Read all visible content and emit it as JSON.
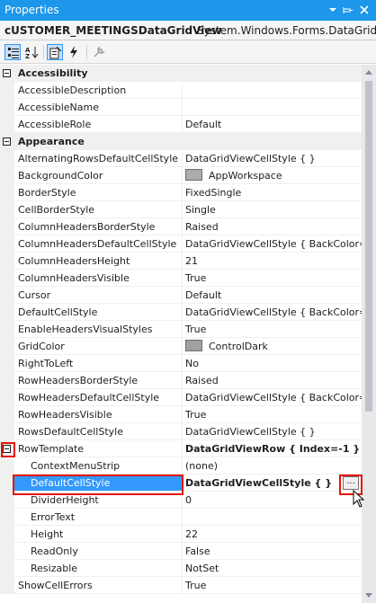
{
  "window": {
    "title": "Properties"
  },
  "object_selector": {
    "name": "cUSTOMER_MEETINGSDataGridView",
    "type": "System.Windows.Forms.DataGridVi"
  },
  "toolbar": {
    "buttons": [
      "categorized-icon",
      "alphabetical-icon",
      "properties-icon",
      "events-icon",
      "property-pages-icon"
    ]
  },
  "colors": {
    "accent": "#1c97ea",
    "selection": "#3399ff",
    "highlight_box": "#e51400",
    "app_workspace": "#ababab",
    "control_dark": "#a0a0a0"
  },
  "grid": {
    "rows": [
      {
        "kind": "category",
        "name": "Accessibility"
      },
      {
        "kind": "prop",
        "name": "AccessibleDescription",
        "value": ""
      },
      {
        "kind": "prop",
        "name": "AccessibleName",
        "value": ""
      },
      {
        "kind": "prop",
        "name": "AccessibleRole",
        "value": "Default"
      },
      {
        "kind": "category",
        "name": "Appearance"
      },
      {
        "kind": "prop",
        "name": "AlternatingRowsDefaultCellStyle",
        "value": "DataGridViewCellStyle { }"
      },
      {
        "kind": "prop",
        "name": "BackgroundColor",
        "value": "AppWorkspace",
        "swatch": "#ababab"
      },
      {
        "kind": "prop",
        "name": "BorderStyle",
        "value": "FixedSingle"
      },
      {
        "kind": "prop",
        "name": "CellBorderStyle",
        "value": "Single"
      },
      {
        "kind": "prop",
        "name": "ColumnHeadersBorderStyle",
        "value": "Raised"
      },
      {
        "kind": "prop",
        "name": "ColumnHeadersDefaultCellStyle",
        "value": "DataGridViewCellStyle { BackColor=C"
      },
      {
        "kind": "prop",
        "name": "ColumnHeadersHeight",
        "value": "21"
      },
      {
        "kind": "prop",
        "name": "ColumnHeadersVisible",
        "value": "True"
      },
      {
        "kind": "prop",
        "name": "Cursor",
        "value": "Default"
      },
      {
        "kind": "prop",
        "name": "DefaultCellStyle",
        "value": "DataGridViewCellStyle { BackColor=C"
      },
      {
        "kind": "prop",
        "name": "EnableHeadersVisualStyles",
        "value": "True"
      },
      {
        "kind": "prop",
        "name": "GridColor",
        "value": "ControlDark",
        "swatch": "#a0a0a0"
      },
      {
        "kind": "prop",
        "name": "RightToLeft",
        "value": "No"
      },
      {
        "kind": "prop",
        "name": "RowHeadersBorderStyle",
        "value": "Raised"
      },
      {
        "kind": "prop",
        "name": "RowHeadersDefaultCellStyle",
        "value": "DataGridViewCellStyle { BackColor=C"
      },
      {
        "kind": "prop",
        "name": "RowHeadersVisible",
        "value": "True"
      },
      {
        "kind": "prop",
        "name": "RowsDefaultCellStyle",
        "value": "DataGridViewCellStyle { }"
      },
      {
        "kind": "expandable",
        "name": "RowTemplate",
        "value": "DataGridViewRow { Index=-1 }",
        "bold": true
      },
      {
        "kind": "child",
        "name": "ContextMenuStrip",
        "value": "(none)"
      },
      {
        "kind": "child",
        "name": "DefaultCellStyle",
        "value": "DataGridViewCellStyle { }",
        "bold": true,
        "selected": true
      },
      {
        "kind": "child",
        "name": "DividerHeight",
        "value": "0"
      },
      {
        "kind": "child",
        "name": "ErrorText",
        "value": ""
      },
      {
        "kind": "child",
        "name": "Height",
        "value": "22"
      },
      {
        "kind": "child",
        "name": "ReadOnly",
        "value": "False"
      },
      {
        "kind": "child",
        "name": "Resizable",
        "value": "NotSet"
      },
      {
        "kind": "prop",
        "name": "ShowCellErrors",
        "value": "True"
      }
    ],
    "ellipsis_label": "..."
  }
}
